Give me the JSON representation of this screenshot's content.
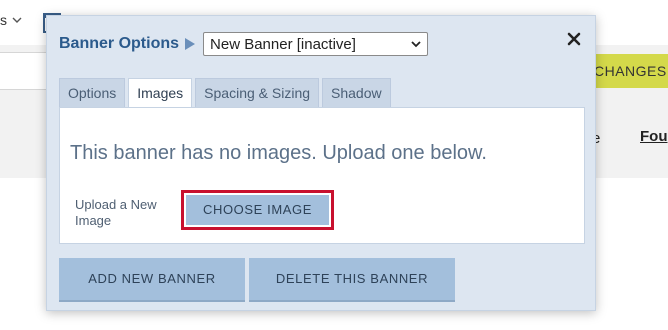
{
  "background": {
    "menu_label": "s",
    "changes_button": "CHANGES",
    "link_partial": "Fou",
    "link_partial_left": "e"
  },
  "modal": {
    "title": "Banner Options",
    "selected_banner": "New Banner [inactive]",
    "close_label": "×",
    "tabs": [
      {
        "label": "Options",
        "active": false
      },
      {
        "label": "Images",
        "active": true
      },
      {
        "label": "Spacing & Sizing",
        "active": false
      },
      {
        "label": "Shadow",
        "active": false
      }
    ],
    "images_panel": {
      "message": "This banner has no images. Upload one below.",
      "upload_label": "Upload a New Image",
      "choose_button": "CHOOSE IMAGE"
    },
    "footer": {
      "add_button": "ADD NEW BANNER",
      "delete_button": "DELETE THIS BANNER"
    }
  },
  "colors": {
    "accent": "#2b5a8c",
    "button_bg": "#a3bfdc",
    "highlight_border": "#c8102e",
    "changes_bg": "#d4d94a"
  }
}
